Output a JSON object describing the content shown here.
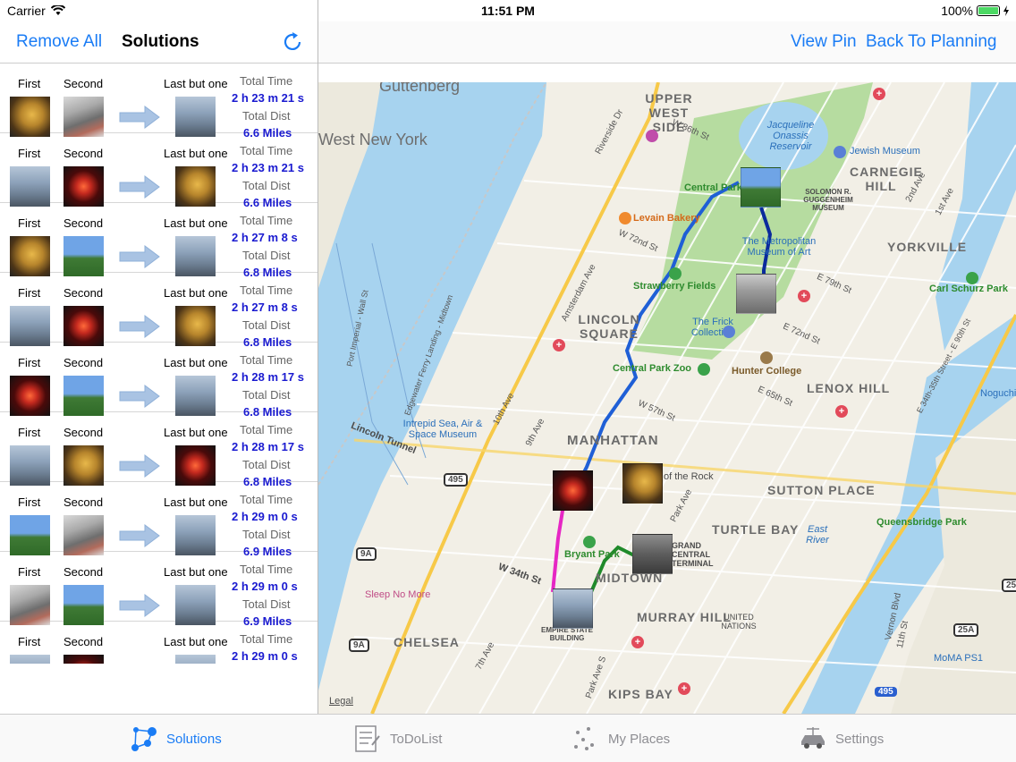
{
  "status_bar": {
    "carrier": "Carrier",
    "time": "11:51 PM",
    "battery": "100%"
  },
  "left_nav": {
    "remove_all": "Remove All",
    "title": "Solutions",
    "refresh_icon": "refresh-icon"
  },
  "right_nav": {
    "view_pin": "View Pin",
    "back_to_planning": "Back To Planning"
  },
  "list_labels": {
    "first": "First",
    "second": "Second",
    "last_but_one": "Last but one",
    "total_time": "Total Time",
    "total_dist": "Total Dist"
  },
  "solutions": [
    {
      "first_photo": "rockefeller-statue",
      "second_photo": "city-street",
      "last_photo": "empire-state-building",
      "total_time": "2 h 23 m 21 s",
      "total_dist": "6.6 Miles"
    },
    {
      "first_photo": "empire-state-building",
      "second_photo": "rockefeller-tree",
      "last_photo": "rockefeller-statue",
      "total_time": "2 h 23 m 21 s",
      "total_dist": "6.6 Miles"
    },
    {
      "first_photo": "rockefeller-statue",
      "second_photo": "central-park",
      "last_photo": "empire-state-building",
      "total_time": "2 h 27 m 8 s",
      "total_dist": "6.8 Miles"
    },
    {
      "first_photo": "empire-state-building",
      "second_photo": "rockefeller-tree",
      "last_photo": "rockefeller-statue",
      "total_time": "2 h 27 m 8 s",
      "total_dist": "6.8 Miles"
    },
    {
      "first_photo": "rockefeller-tree",
      "second_photo": "central-park",
      "last_photo": "empire-state-building",
      "total_time": "2 h 28 m 17 s",
      "total_dist": "6.8 Miles"
    },
    {
      "first_photo": "empire-state-building",
      "second_photo": "rockefeller-statue",
      "last_photo": "rockefeller-tree",
      "total_time": "2 h 28 m 17 s",
      "total_dist": "6.8 Miles"
    },
    {
      "first_photo": "central-park",
      "second_photo": "city-street",
      "last_photo": "empire-state-building",
      "total_time": "2 h 29 m 0 s",
      "total_dist": "6.9 Miles"
    },
    {
      "first_photo": "city-street",
      "second_photo": "central-park",
      "last_photo": "empire-state-building",
      "total_time": "2 h 29 m 0 s",
      "total_dist": "6.9 Miles"
    },
    {
      "first_photo": "empire-state-building",
      "second_photo": "rockefeller-tree",
      "last_photo": "empire-state-building",
      "total_time": "2 h 29 m 0 s",
      "total_dist": ""
    }
  ],
  "map": {
    "labels": {
      "guttenberg": "Guttenberg",
      "west_new_york": "West New York",
      "upper_west_side": "UPPER WEST SIDE",
      "jacqueline": "Jacqueline Onassis Reservoir",
      "jewish_museum": "Jewish Museum",
      "carnegie_hill": "CARNEGIE HILL",
      "central_park": "Central Park",
      "guggenheim": "SOLOMON R. GUGGENHEIM MUSEUM",
      "levain": "Levain Bakery",
      "met": "The Metropolitan Museum of Art",
      "yorkville": "YORKVILLE",
      "strawberry": "Strawberry Fields",
      "carl_schurz": "Carl Schurz Park",
      "lincoln_square": "LINCOLN SQUARE",
      "frick": "The Frick Collection",
      "central_park_zoo": "Central Park Zoo",
      "hunter": "Hunter College",
      "lenox_hill": "LENOX HILL",
      "noguchi": "Noguchi",
      "intrepid": "Intrepid Sea, Air & Space Museum",
      "lincoln_tunnel": "Lincoln Tunnel",
      "manhattan": "MANHATTAN",
      "top_of_rock": "of the Rock",
      "sutton_place": "SUTTON PLACE",
      "turtle_bay": "TURTLE BAY",
      "queensboro": "Queensbridge Park",
      "east_river": "East River",
      "bryant_park": "Bryant Park",
      "grand_central": "GRAND CENTRAL TERMINAL",
      "midtown": "MIDTOWN",
      "sleep_no_more": "Sleep No More",
      "w34th": "W 34th St",
      "murray_hill": "MURRAY HILL",
      "united_nations": "UNITED NATIONS",
      "empire_state": "EMPIRE STATE BUILDING",
      "chelsea": "CHELSEA",
      "kips_bay": "KIPS BAY",
      "moma_ps1": "MoMA PS1",
      "legal": "Legal",
      "w86th": "W 86th St",
      "w72nd": "W 72nd St",
      "w57th": "W 57th St",
      "e79th": "E 79th St",
      "e72nd": "E 72nd St",
      "e65th": "E 65th St",
      "amsterdam": "Amsterdam Ave",
      "tenth": "10th Ave",
      "ninth": "9th Ave",
      "park_ave": "Park Ave",
      "riverside": "Riverside Dr",
      "port_imperial": "Port Imperial - Wall St",
      "edgewater": "Edgewater Ferry Landing - Midtown",
      "ave1": "1st Ave",
      "ave2": "2nd Ave",
      "fdr": "E 34th-35th Street - E 90th St",
      "vernon": "Vernon Blvd",
      "eleventh": "11th St",
      "park_ave_s": "Park Ave S",
      "seventh": "7th Ave",
      "shield_495": "495",
      "shield_9a": "9A",
      "shield_25a": "25A",
      "shield_25": "25"
    }
  },
  "tabs": [
    {
      "label": "Solutions",
      "icon": "solutions-network-icon",
      "active": true
    },
    {
      "label": "ToDoList",
      "icon": "todo-list-icon",
      "active": false
    },
    {
      "label": "My Places",
      "icon": "my-places-icon",
      "active": false
    },
    {
      "label": "Settings",
      "icon": "settings-car-icon",
      "active": false
    }
  ],
  "colors": {
    "accent": "#1a7cf5",
    "route_blue": "#1f5fd6",
    "route_navy": "#0a2a9c",
    "route_pink": "#e626c4",
    "route_green": "#1f8a2a",
    "water": "#a7d3ef",
    "park": "#b6dca0"
  }
}
